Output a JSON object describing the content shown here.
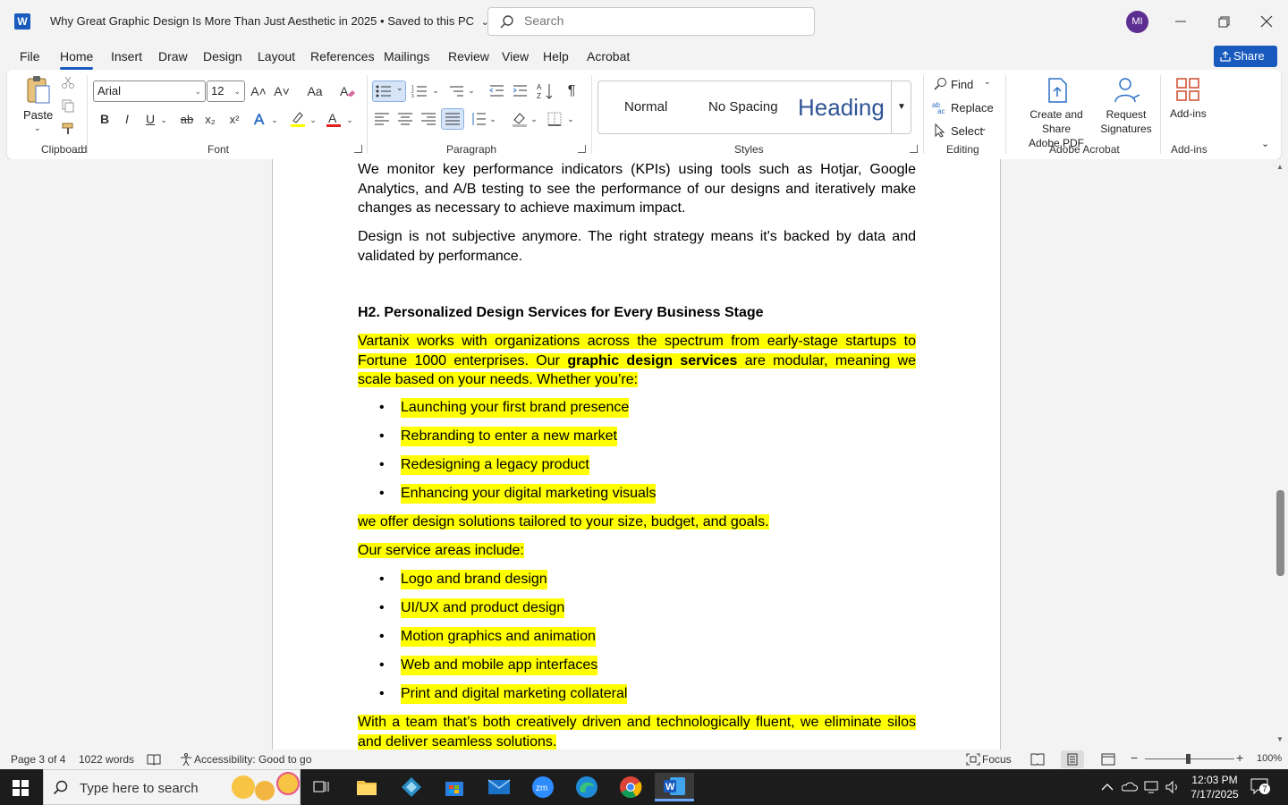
{
  "titlebar": {
    "doc_title": "Why Great Graphic Design Is More Than Just Aesthetic in 2025",
    "save_status": "Saved to this PC",
    "search_placeholder": "Search",
    "avatar_initials": "MI"
  },
  "tabs": [
    "File",
    "Home",
    "Insert",
    "Draw",
    "Design",
    "Layout",
    "References",
    "Mailings",
    "Review",
    "View",
    "Help",
    "Acrobat"
  ],
  "active_tab": "Home",
  "share_label": "Share",
  "ribbon": {
    "clipboard": {
      "paste_label": "Paste",
      "group_label": "Clipboard"
    },
    "font": {
      "font_name": "Arial",
      "font_size": "12",
      "group_label": "Font",
      "bold": "B",
      "italic": "I",
      "underline": "U",
      "strike": "ab",
      "subscript": "x₂",
      "superscript": "x²",
      "grow": "A˄",
      "shrink": "A˅",
      "change_case": "Aa"
    },
    "paragraph": {
      "group_label": "Paragraph",
      "pilcrow": "¶"
    },
    "styles": {
      "group_label": "Styles",
      "normal": "Normal",
      "no_spacing": "No Spacing",
      "heading": "Heading"
    },
    "editing": {
      "group_label": "Editing",
      "find": "Find",
      "replace": "Replace",
      "select": "Select"
    },
    "acrobat": {
      "group_label": "Adobe Acrobat",
      "create_share_line1": "Create and Share",
      "create_share_line2": "Adobe PDF",
      "request_line1": "Request",
      "request_line2": "Signatures"
    },
    "addins": {
      "group_label": "Add-ins",
      "addins_label": "Add-ins"
    }
  },
  "document": {
    "para1": "We monitor key performance indicators (KPIs) using tools such as Hotjar, Google Analytics, and A/B testing to see the performance of our designs and iteratively make changes as necessary to achieve maximum impact.",
    "para2": "Design is not subjective anymore. The right strategy means it's backed by data and validated by performance.",
    "heading": "H2. Personalized Design Services for Every Business Stage",
    "para3_a": "Vartanix works with organizations across the spectrum from early-stage startups to Fortune 1000 enterprises. Our ",
    "para3_bold": "graphic design services",
    "para3_b": " are modular, meaning we scale based on your needs. Whether you’re:",
    "list1": [
      "Launching your first brand presence",
      "Rebranding to enter a new market",
      "Redesigning a legacy product",
      "Enhancing your digital marketing visuals"
    ],
    "para4": "we offer design solutions tailored to your size, budget, and goals.",
    "para5": "Our service areas include:",
    "list2": [
      "Logo and brand design",
      "UI/UX and product design",
      "Motion graphics and animation",
      "Web and mobile app interfaces",
      "Print and digital marketing collateral"
    ],
    "para6": "With a team that’s both creatively driven and technologically fluent, we eliminate silos and deliver seamless solutions."
  },
  "statusbar": {
    "page": "Page 3 of 4",
    "words": "1022 words",
    "accessibility": "Accessibility: Good to go",
    "focus": "Focus",
    "zoom": "100%"
  },
  "taskbar": {
    "search_placeholder": "Type here to search",
    "time": "12:03 PM",
    "date": "7/17/2025",
    "notifications": "7"
  },
  "colors": {
    "accent": "#185abd",
    "highlight": "#ffff00",
    "heading_style": "#2f5496"
  }
}
